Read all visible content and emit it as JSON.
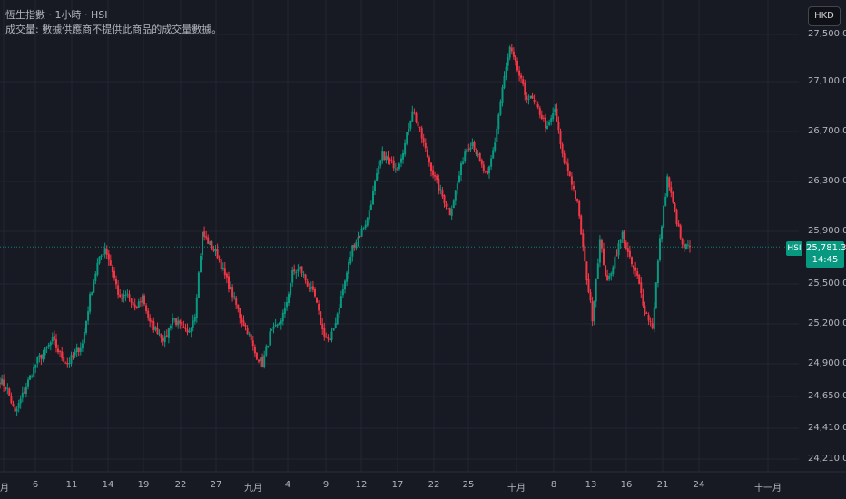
{
  "legend": {
    "symbol_name": "恆生指數",
    "interval": "1小時",
    "exchange": "HSI",
    "volume_note": "成交量: 數據供應商不提供此商品的成交量數據。"
  },
  "currency_button": "HKD",
  "last_price": {
    "symbol": "HSI",
    "value": "25,781.39",
    "countdown": "14:45"
  },
  "colors": {
    "background": "#171a23",
    "grid": "#232632",
    "up": "#089981",
    "down": "#f23645",
    "text": "#b2b5be"
  },
  "chart_data": {
    "type": "candlestick",
    "y_axis": {
      "ticks": [
        "27,500.00",
        "27,100.00",
        "26,700.00",
        "26,300.00",
        "25,900.00",
        "25,500.00",
        "25,200.00",
        "24,900.00",
        "24,650.00",
        "24,410.00",
        "24,210.00"
      ],
      "range": [
        24130,
        27600
      ]
    },
    "x_axis": {
      "ticks": [
        "月",
        "6",
        "11",
        "14",
        "19",
        "22",
        "27",
        "九月",
        "4",
        "9",
        "12",
        "17",
        "22",
        "25",
        "十月",
        "8",
        "13",
        "16",
        "21",
        "24",
        "十一月"
      ]
    },
    "last_value": 25781.39,
    "closes": [
      24780,
      24700,
      24520,
      24660,
      24800,
      24930,
      24990,
      25080,
      24970,
      24900,
      24980,
      25050,
      25400,
      25650,
      25780,
      25600,
      25380,
      25420,
      25300,
      25410,
      25200,
      25150,
      25080,
      25250,
      25180,
      25120,
      25280,
      25880,
      25800,
      25720,
      25560,
      25420,
      25260,
      25150,
      24980,
      24900,
      25120,
      25180,
      25300,
      25580,
      25620,
      25500,
      25400,
      25150,
      25060,
      25280,
      25520,
      25780,
      25880,
      26000,
      26280,
      26520,
      26450,
      26420,
      26600,
      26880,
      26700,
      26500,
      26320,
      26180,
      26050,
      26280,
      26550,
      26620,
      26450,
      26330,
      26620,
      27050,
      27380,
      27200,
      27000,
      26950,
      26850,
      26720,
      26880,
      26500,
      26350,
      26120,
      25650,
      25250,
      25830,
      25500,
      25700,
      25880,
      25680,
      25550,
      25300,
      25180,
      25830,
      26330,
      26050,
      25780,
      25781
    ]
  }
}
